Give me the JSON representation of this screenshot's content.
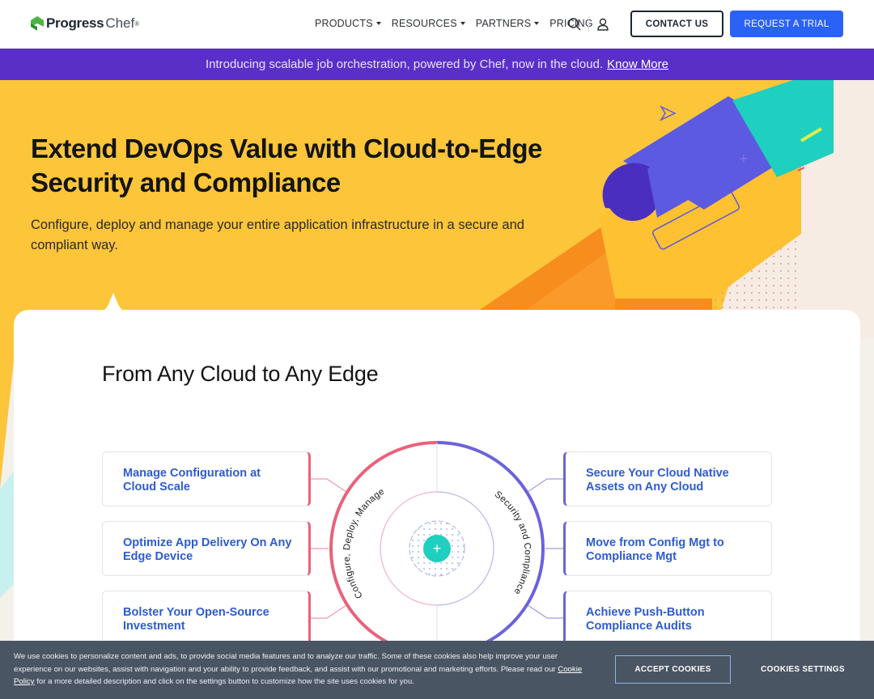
{
  "header": {
    "logo_progress": "Progress",
    "logo_chef": "Chef",
    "logo_tm": "®",
    "nav": [
      {
        "label": "PRODUCTS"
      },
      {
        "label": "RESOURCES"
      },
      {
        "label": "PARTNERS"
      },
      {
        "label": "PRICING"
      }
    ],
    "contact_label": "CONTACT US",
    "trial_label": "REQUEST A TRIAL"
  },
  "announcement": {
    "text": "Introducing scalable job orchestration, powered by Chef, now in the cloud.",
    "link": "Know More"
  },
  "hero": {
    "title": "Extend DevOps Value with Cloud-to-Edge Security and Compliance",
    "subtitle": "Configure, deploy and manage your entire application infrastructure in a secure and compliant way."
  },
  "section": {
    "title": "From Any Cloud to Any Edge",
    "features_left": [
      {
        "label": "Manage Configuration at Cloud Scale"
      },
      {
        "label": "Optimize App Delivery On Any Edge Device"
      },
      {
        "label": "Bolster Your Open-Source Investment"
      }
    ],
    "features_right": [
      {
        "label": "Secure Your Cloud Native Assets on Any Cloud"
      },
      {
        "label": "Move from Config Mgt to Compliance Mgt"
      },
      {
        "label": "Achieve Push-Button Compliance Audits"
      }
    ],
    "ring_left": "Configure, Deploy, Manage",
    "ring_right": "Security and Compliance",
    "center_symbol": "+"
  },
  "cookie": {
    "text_before_link": "We use cookies to personalize content and ads, to provide social media features and to analyze our traffic. Some of these cookies also help improve your user experience on our websites, assist with navigation and your ability to provide feedback, and assist with our promotional and marketing efforts. Please read our ",
    "link": "Cookie Policy",
    "text_after_link": " for a more detailed description and click on the settings button to customize how the site uses cookies for you.",
    "accept_label": "ACCEPT COOKIES",
    "settings_label": "COOKIES SETTINGS"
  },
  "icons": {
    "search": "search-icon",
    "user": "user-icon"
  },
  "colors": {
    "brand_blue": "#2b62f6",
    "announce_purple": "#5a2fc8",
    "hero_yellow": "#fcc53a",
    "link_blue": "#2d5bd0",
    "ring_red": "#e8627a",
    "ring_purple": "#6a63dc",
    "teal": "#1fcfbf",
    "cookie_bg": "#4a5563"
  }
}
